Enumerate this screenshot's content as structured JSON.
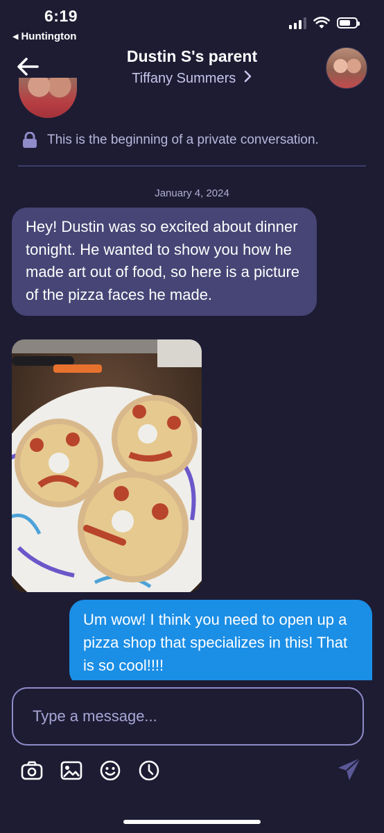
{
  "status_bar": {
    "time": "6:19",
    "back_app": "Huntington"
  },
  "header": {
    "title": "Dustin S's parent",
    "subtitle": "Tiffany Summers",
    "subtitle_chevron": "›"
  },
  "conversation": {
    "private_notice": "This is the beginning of a private conversation.",
    "date": "January 4, 2024",
    "messages": [
      {
        "direction": "incoming",
        "text": "Hey! Dustin was so excited about dinner tonight. He wanted to show you how he made art out of food, so here is a picture of the pizza faces he made."
      },
      {
        "direction": "incoming",
        "type": "image",
        "image_icon": "pizza-faces-photo"
      },
      {
        "direction": "outgoing",
        "text": "Um wow! I think you need to open up a pizza shop that specializes in this! That is so cool!!!!"
      }
    ]
  },
  "composer": {
    "placeholder": "Type a message...",
    "value": ""
  },
  "colors": {
    "background": "#1d1c33",
    "incoming_bubble": "#464575",
    "outgoing_bubble": "#1b8ee6",
    "accent_muted": "#8f8cc9"
  },
  "icons": [
    "back-arrow-icon",
    "lock-icon",
    "camera-icon",
    "image-icon",
    "emoji-icon",
    "clock-icon",
    "send-icon"
  ]
}
